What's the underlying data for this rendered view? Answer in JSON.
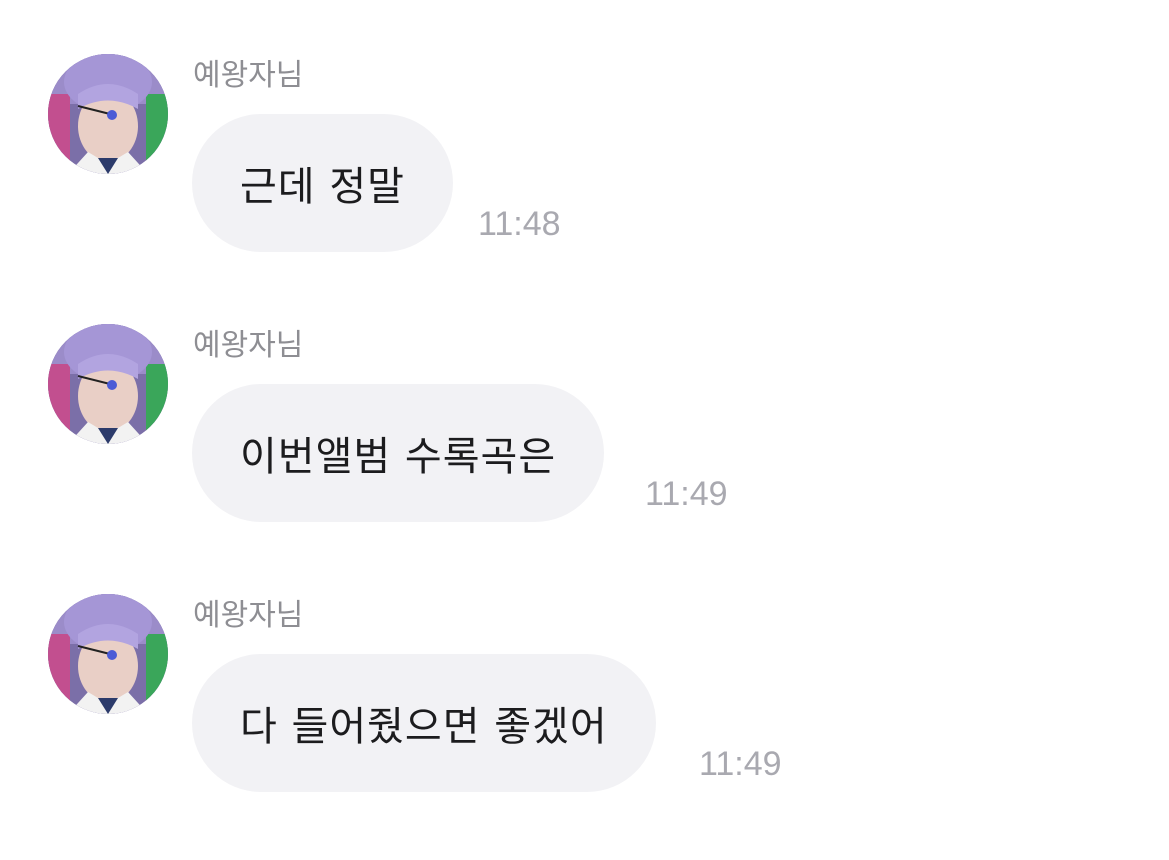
{
  "chat": {
    "messages": [
      {
        "sender": "예왕자님",
        "text": "근데 정말",
        "time": "11:48"
      },
      {
        "sender": "예왕자님",
        "text": "이번앨범 수록곡은",
        "time": "11:49"
      },
      {
        "sender": "예왕자님",
        "text": "다 들어줬으면 좋겠어",
        "time": "11:49"
      }
    ]
  },
  "colors": {
    "bubble_background": "#f2f2f5",
    "sender_name": "#8e8e93",
    "timestamp": "#a9a9b0",
    "message_text": "#1c1c1e"
  },
  "icons": {
    "avatar": "profile-photo-avatar"
  }
}
